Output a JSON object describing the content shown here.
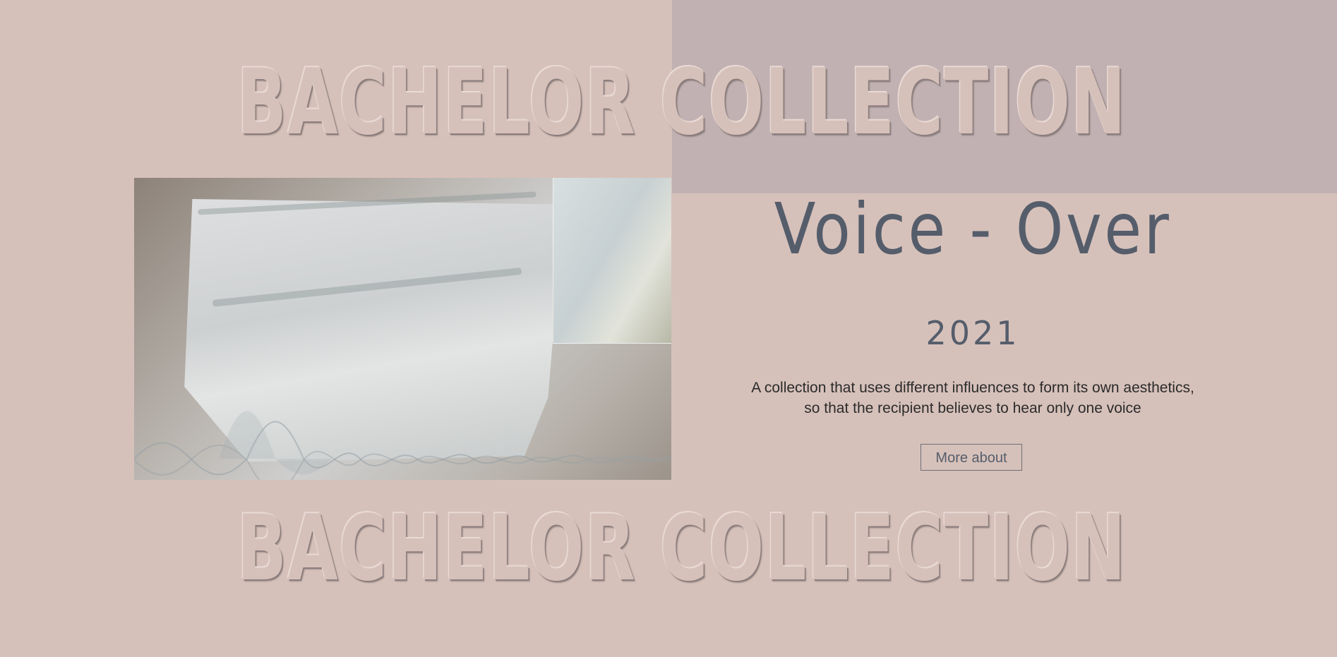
{
  "header": {
    "collection_title_top": "BACHELOR COLLECTION",
    "collection_title_bottom": "BACHELOR COLLECTION"
  },
  "project": {
    "title": "Voice - Over",
    "year": "2021",
    "description_line1": "A collection that uses different influences to form its own aesthetics,",
    "description_line2": "so that the recipient believes to hear only one voice",
    "more_button_label": "More about"
  },
  "colors": {
    "background": "#d6c1ba",
    "top_right_panel": "#c1b1b2",
    "title_text": "#555d6b",
    "body_text": "#2b2b2b"
  }
}
